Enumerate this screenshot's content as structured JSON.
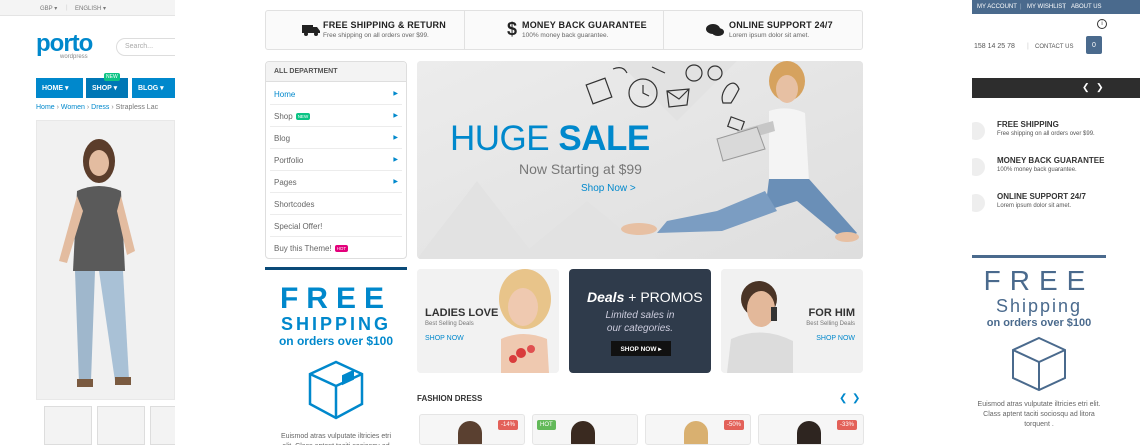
{
  "left_page": {
    "currency": "GBP ▾",
    "language": "ENGLISH ▾",
    "logo": "porto",
    "logo_sub": "wordpress",
    "search_placeholder": "Search...",
    "nav": [
      {
        "label": "HOME ▾"
      },
      {
        "label": "SHOP ▾",
        "badge": "NEW"
      },
      {
        "label": "BLOG ▾"
      }
    ],
    "breadcrumb": [
      "Home",
      "Women",
      "Dress",
      "Strapless Lac"
    ]
  },
  "right_page": {
    "top_links": [
      "MY ACCOUNT",
      "MY WISHLIST",
      "ABOUT US"
    ],
    "phone": "158 14 25 78",
    "contact": "CONTACT US",
    "cart_count": "0",
    "info_icon": "i",
    "features": [
      {
        "title": "FREE SHIPPING",
        "sub": "Free shipping on all orders over $99."
      },
      {
        "title": "MONEY BACK GUARANTEE",
        "sub": "100% money back guarantee."
      },
      {
        "title": "ONLINE SUPPORT 24/7",
        "sub": "Lorem ipsum dolor sit amet."
      }
    ],
    "free_big": "FREE",
    "free_mid": "Shipping",
    "free_small": "on orders over $100",
    "text": "Euismod atras vulputate iltricies etri elit. Class aptent taciti sociosqu ad litora torquent ."
  },
  "features": [
    {
      "icon": "truck-icon",
      "title": "FREE SHIPPING & RETURN",
      "sub": "Free shipping on all orders over $99."
    },
    {
      "icon": "dollar-icon",
      "title": "MONEY BACK GUARANTEE",
      "sub": "100% money back guarantee."
    },
    {
      "icon": "chat-icon",
      "title": "ONLINE SUPPORT 24/7",
      "sub": "Lorem ipsum dolor sit amet."
    }
  ],
  "menu": {
    "header": "ALL DEPARTMENT",
    "items": [
      {
        "label": "Home",
        "arrow": true,
        "active": true
      },
      {
        "label": "Shop",
        "arrow": true,
        "badge": "NEW",
        "badge_color": "#0cc485"
      },
      {
        "label": "Blog",
        "arrow": true
      },
      {
        "label": "Portfolio",
        "arrow": true
      },
      {
        "label": "Pages",
        "arrow": true
      },
      {
        "label": "Shortcodes",
        "arrow": false
      },
      {
        "label": "Special Offer!",
        "arrow": false
      },
      {
        "label": "Buy this Theme!",
        "arrow": false,
        "badge": "HOT",
        "badge_color": "#e3007b"
      }
    ]
  },
  "hero": {
    "title_light": "HUGE ",
    "title_bold": "SALE",
    "sub": "Now Starting at $99",
    "link": "Shop Now >"
  },
  "free_block": {
    "big": "FREE",
    "mid": "SHIPPING",
    "small": "on orders over $100",
    "text": "Euismod atras vulputate iltricies etri elit. Class aptent taciti sociosqu ad litora torquent ."
  },
  "promos": [
    {
      "title": "LADIES LOVE",
      "sub": "Best Selling Deals",
      "link": "SHOP NOW"
    },
    {
      "title_em": "Deals",
      "title_rest": " + PROMOS",
      "sub": "Limited sales in our categories.",
      "button": "SHOP NOW ▸"
    },
    {
      "title": "FOR HIM",
      "sub": "Best Selling Deals",
      "link": "SHOP NOW"
    }
  ],
  "fashion": {
    "title": "FASHION DRESS",
    "prev": "❮",
    "next": "❯",
    "products": [
      {
        "badge": "-14%",
        "badge_color": "#e36159"
      },
      {
        "badge": "HOT",
        "badge_color": "#62b959"
      },
      {
        "badge": "-50%",
        "badge_color": "#e36159"
      },
      {
        "badge": "-33%",
        "badge_color": "#e36159"
      }
    ]
  },
  "colors": {
    "accent": "#0088cc",
    "dark_blue": "#0a4a78",
    "promo_dark": "#2f3b4b",
    "right_page_accent": "#4a6a8d"
  }
}
